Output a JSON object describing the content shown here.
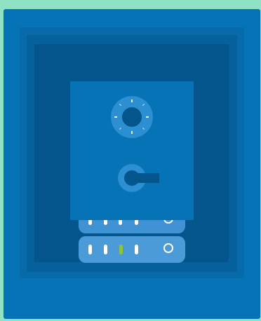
{
  "scene": {
    "description_icon": "vault-with-servers-icon",
    "colors": {
      "background": "#8fe2c3",
      "frame": "#0673b7",
      "recess_dark": "#03558c",
      "accent": "#2b8fd1",
      "server": "#4a9bd8",
      "indicator_active": "#8bc43f",
      "indicator": "#ffffff"
    }
  },
  "safe": {
    "dial_icon": "combination-dial-icon",
    "handle_icon": "safe-handle-icon"
  },
  "servers": [
    {
      "name": "server-unit-back",
      "indicators": [
        "on",
        "on",
        "on",
        "on"
      ],
      "power_icon": "power-ring-icon"
    },
    {
      "name": "server-unit-front",
      "indicators": [
        "on",
        "on",
        "active",
        "on"
      ],
      "power_icon": "power-ring-icon"
    }
  ]
}
